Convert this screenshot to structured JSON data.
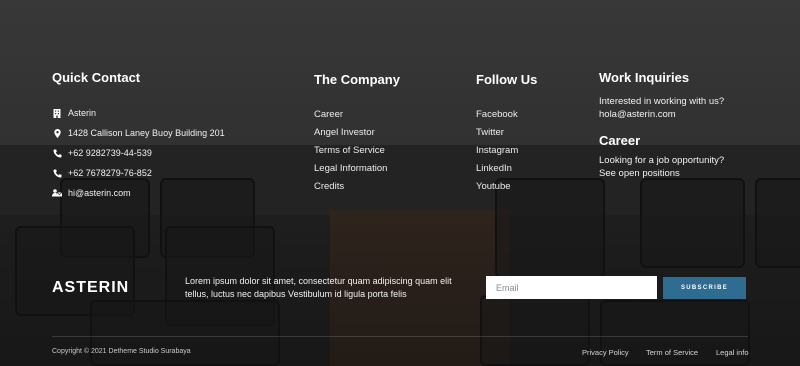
{
  "quick_contact": {
    "heading": "Quick Contact",
    "items": [
      {
        "icon": "building-icon",
        "text": "Asterin"
      },
      {
        "icon": "map-pin-icon",
        "text": "1428 Callison Laney Buoy Building 201"
      },
      {
        "icon": "phone-icon",
        "text": "+62 9282739-44-539"
      },
      {
        "icon": "phone-icon",
        "text": "+62 7678279-76-852"
      },
      {
        "icon": "email-icon",
        "text": "hi@asterin.com"
      }
    ]
  },
  "company": {
    "heading": "The Company",
    "links": [
      "Career",
      "Angel Investor",
      "Terms of Service",
      "Legal Information",
      "Credits"
    ]
  },
  "follow": {
    "heading": "Follow Us",
    "links": [
      "Facebook",
      "Twitter",
      "Instagram",
      "LinkedIn",
      "Youtube"
    ]
  },
  "work": {
    "heading": "Work Inquiries",
    "line1": "Interested in working with us?",
    "email": "hola@asterin.com",
    "career_heading": "Career",
    "career_line1": "Looking for a job opportunity?",
    "career_link": "See open positions"
  },
  "brand": "ASTERIN",
  "about": "Lorem ipsum dolor sit amet, consectetur quam adipiscing quam elit tellus, luctus nec dapibus Vestibulum id ligula porta felis",
  "newsletter": {
    "placeholder": "Email",
    "button": "SUBSCRIBE",
    "button_color": "#2f6c92"
  },
  "bottom": {
    "copyright": "Copyright © 2021 Detheme Studio Surabaya",
    "links": [
      "Privacy Policy",
      "Term of Service",
      "Legal info"
    ]
  }
}
